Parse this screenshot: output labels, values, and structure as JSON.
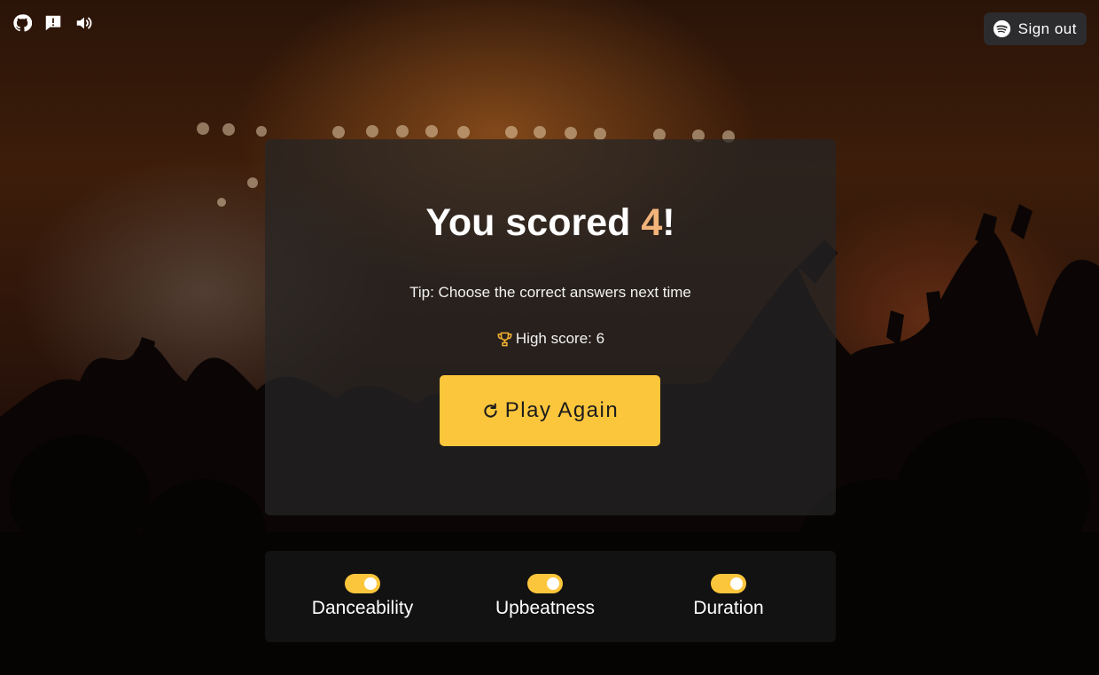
{
  "header": {
    "icons": [
      "github-icon",
      "feedback-icon",
      "volume-icon"
    ],
    "signout_label": "Sign out",
    "signout_icon": "spotify-icon"
  },
  "result": {
    "prefix": "You scored ",
    "score": "4",
    "suffix": "!",
    "tip": "Tip: Choose the correct answers next time",
    "high_score": "High score: 6",
    "play_again_label": "Play Again"
  },
  "settings": {
    "toggles": [
      {
        "label": "Danceability",
        "on": true
      },
      {
        "label": "Upbeatness",
        "on": true
      },
      {
        "label": "Duration",
        "on": true
      }
    ]
  },
  "colors": {
    "accent": "#fcc63c",
    "score": "#f2b47a"
  }
}
